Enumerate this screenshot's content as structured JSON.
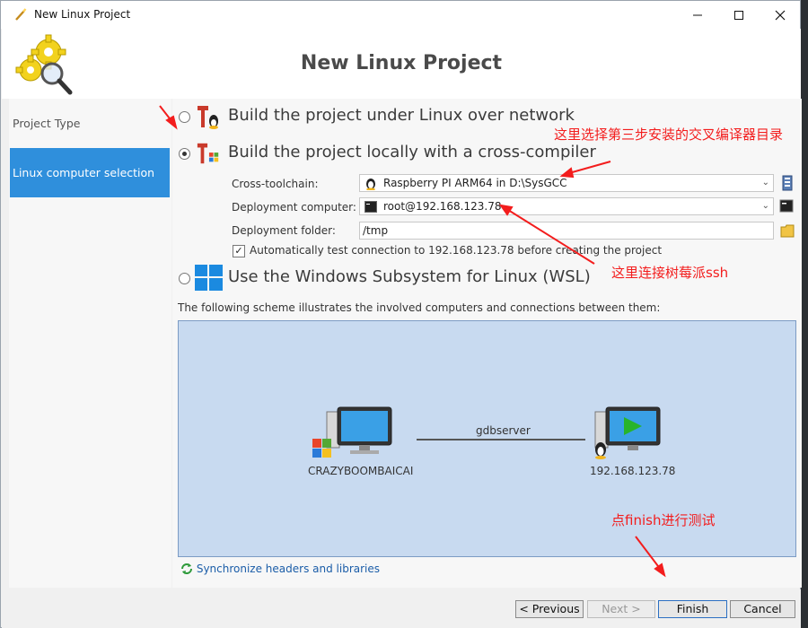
{
  "window": {
    "title": "New Linux Project",
    "header_title": "New Linux Project"
  },
  "sidebar": {
    "items": [
      {
        "label": "Project Type"
      },
      {
        "label": "Linux computer selection"
      }
    ]
  },
  "options": {
    "network": {
      "label": "Build the project under Linux over network",
      "selected": false
    },
    "cross": {
      "label": "Build the project locally with a cross-compiler",
      "selected": true
    },
    "wsl": {
      "label": "Use the Windows Subsystem for Linux (WSL)",
      "selected": false
    }
  },
  "fields": {
    "toolchain": {
      "label": "Cross-toolchain:",
      "value": "Raspberry PI ARM64 in D:\\SysGCC"
    },
    "deploy_computer": {
      "label": "Deployment computer:",
      "value": "root@192.168.123.78"
    },
    "deploy_folder": {
      "label": "Deployment folder:",
      "value": "/tmp"
    },
    "auto_test": {
      "label": "Automatically test connection to 192.168.123.78 before creating the project",
      "checked": true
    }
  },
  "scheme": {
    "caption": "The following scheme illustrates the involved computers and connections between them:",
    "local_computer": "CRAZYBOOMBAICAI",
    "connection": "gdbserver",
    "remote_computer": "192.168.123.78"
  },
  "sync_link": "Synchronize headers and libraries",
  "buttons": {
    "previous": "< Previous",
    "next": "Next >",
    "finish": "Finish",
    "cancel": "Cancel"
  },
  "annotations": {
    "toolchain_note": "这里选择第三步安装的交叉编译器目录",
    "ssh_note": "这里连接树莓派ssh",
    "finish_note": "点finish进行测试"
  },
  "colors": {
    "selection_blue": "#2f8fdc",
    "scheme_bg": "#c8daf0",
    "annotation_red": "#f31d1d",
    "link_blue": "#1b5da8"
  }
}
